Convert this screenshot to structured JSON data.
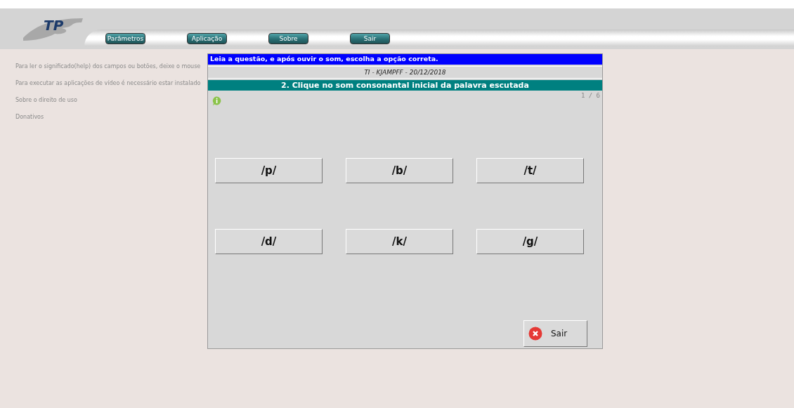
{
  "header": {
    "logo": "TP",
    "menu": [
      {
        "label": "Parâmetros"
      },
      {
        "label": "Aplicação"
      },
      {
        "label": "Sobre"
      },
      {
        "label": "Sair"
      }
    ]
  },
  "help_links": [
    "Para ler o significado(help) dos campos ou botões, deixe o mouse",
    "Para executar as aplicações de vídeo é necessário estar instalado",
    "Sobre o direito de uso",
    "Donativos"
  ],
  "dialog": {
    "instruction": "Leia a questão, e após ouvir o som, escolha a opção correta.",
    "subtitle": "TI - KJAMPFF - 20/12/2018",
    "question": "2. Clique no som consonantal inicial da palavra escutada",
    "progress": "1 / 6",
    "options": [
      "/p/",
      "/b/",
      "/t/",
      "/d/",
      "/k/",
      "/g/"
    ],
    "exit_button": "Sair"
  }
}
